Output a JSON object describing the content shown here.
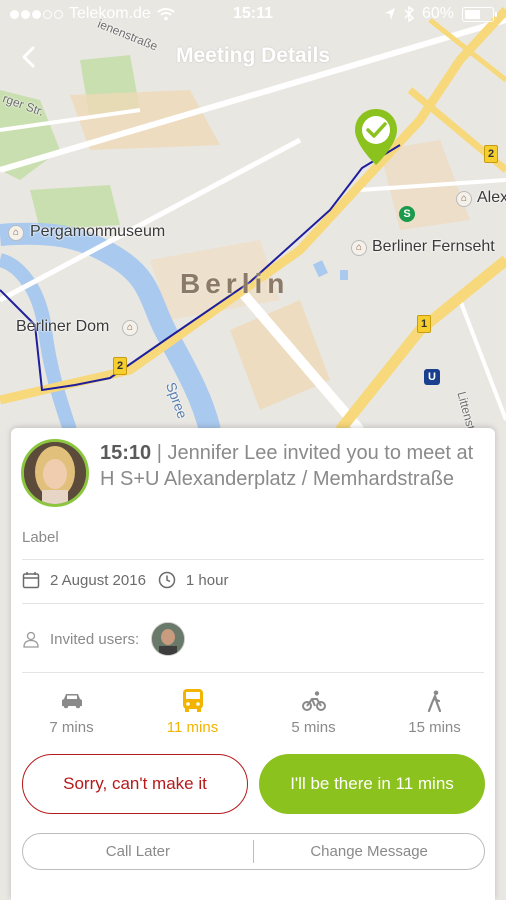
{
  "status_bar": {
    "carrier": "Telekom.de",
    "time": "15:11",
    "battery": "60%",
    "battery_level": 0.6
  },
  "nav": {
    "title": "Meeting Details"
  },
  "map": {
    "labels": {
      "city": "Berlin",
      "pergamon": "Pergamonmuseum",
      "dom": "Berliner Dom",
      "fernseh": "Berliner Fernseht",
      "alex": "Alex",
      "spree": "Spree",
      "litten": "Littenstraße",
      "ger_str": "rger Str.",
      "ienen": "ienenstraße"
    },
    "road_numbers": [
      "2",
      "2",
      "1"
    ],
    "transit": {
      "s": "S",
      "u": "U"
    }
  },
  "meeting": {
    "time": "15:10",
    "text": " | Jennifer Lee invited you to meet at H S+U Alexanderplatz / Memhardstraße",
    "label": "Label",
    "date": "2 August 2016",
    "duration": "1 hour",
    "invited_label": "Invited users:"
  },
  "modes": [
    {
      "name": "car",
      "time": "7 mins",
      "icon": "car-icon"
    },
    {
      "name": "bus",
      "time": "11 mins",
      "icon": "bus-icon",
      "active": true
    },
    {
      "name": "bike",
      "time": "5 mins",
      "icon": "bike-icon"
    },
    {
      "name": "walk",
      "time": "15 mins",
      "icon": "walk-icon"
    }
  ],
  "actions": {
    "decline": "Sorry, can't make it",
    "accept": "I'll be there in 11 mins",
    "call_later": "Call Later",
    "change_message": "Change Message"
  },
  "colors": {
    "accent_green": "#8cc21e",
    "decline_red": "#b51a1a",
    "active_mode": "#f2b400"
  }
}
